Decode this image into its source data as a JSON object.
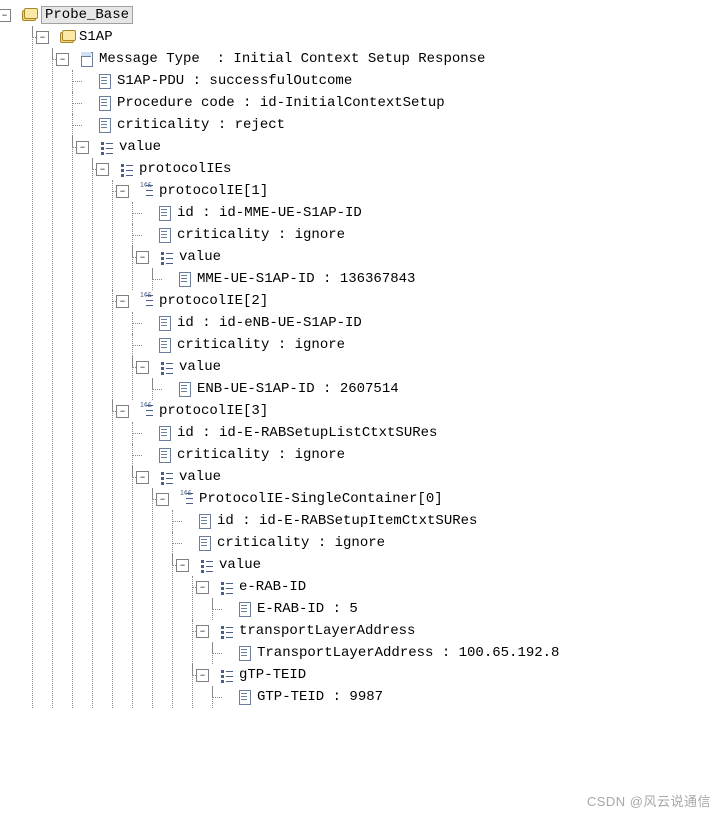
{
  "watermark": "CSDN @风云说通信",
  "tree": [
    {
      "name": "root-probe-base",
      "icon": "ic-folder",
      "exp": "minus",
      "label": "Probe_Base",
      "highlight": true,
      "interact": true,
      "children": [
        {
          "name": "node-s1ap",
          "icon": "ic-folder",
          "exp": "minus",
          "label": "S1AP",
          "interact": true,
          "children": [
            {
              "name": "node-message-type",
              "icon": "ic-page-head",
              "exp": "minus",
              "label": "Message Type  : Initial Context Setup Response",
              "interact": true,
              "children": [
                {
                  "name": "leaf-s1ap-pdu",
                  "icon": "ic-page",
                  "exp": "none",
                  "label": "S1AP-PDU : successfulOutcome",
                  "interact": false
                },
                {
                  "name": "leaf-procedure-code",
                  "icon": "ic-page",
                  "exp": "none",
                  "label": "Procedure code : id-InitialContextSetup",
                  "interact": false
                },
                {
                  "name": "leaf-criticality-top",
                  "icon": "ic-page",
                  "exp": "none",
                  "label": "criticality : reject",
                  "interact": false
                },
                {
                  "name": "node-value-top",
                  "icon": "ic-list",
                  "exp": "minus",
                  "label": "value",
                  "interact": true,
                  "children": [
                    {
                      "name": "node-protocolies",
                      "icon": "ic-list",
                      "exp": "minus",
                      "label": "protocolIEs",
                      "interact": true,
                      "children": [
                        {
                          "name": "node-protocolie-1",
                          "icon": "ic-nlist",
                          "exp": "minus",
                          "label": "protocolIE[1]",
                          "interact": true,
                          "children": [
                            {
                              "name": "leaf-ie1-id",
                              "icon": "ic-page",
                              "exp": "none",
                              "label": "id : id-MME-UE-S1AP-ID",
                              "interact": false
                            },
                            {
                              "name": "leaf-ie1-crit",
                              "icon": "ic-page",
                              "exp": "none",
                              "label": "criticality : ignore",
                              "interact": false
                            },
                            {
                              "name": "node-ie1-value",
                              "icon": "ic-list",
                              "exp": "minus",
                              "label": "value",
                              "interact": true,
                              "children": [
                                {
                                  "name": "leaf-mme-ue-s1ap-id",
                                  "icon": "ic-page",
                                  "exp": "none",
                                  "label": "MME-UE-S1AP-ID : 136367843",
                                  "interact": false
                                }
                              ]
                            }
                          ]
                        },
                        {
                          "name": "node-protocolie-2",
                          "icon": "ic-nlist",
                          "exp": "minus",
                          "label": "protocolIE[2]",
                          "interact": true,
                          "children": [
                            {
                              "name": "leaf-ie2-id",
                              "icon": "ic-page",
                              "exp": "none",
                              "label": "id : id-eNB-UE-S1AP-ID",
                              "interact": false
                            },
                            {
                              "name": "leaf-ie2-crit",
                              "icon": "ic-page",
                              "exp": "none",
                              "label": "criticality : ignore",
                              "interact": false
                            },
                            {
                              "name": "node-ie2-value",
                              "icon": "ic-list",
                              "exp": "minus",
                              "label": "value",
                              "interact": true,
                              "children": [
                                {
                                  "name": "leaf-enb-ue-s1ap-id",
                                  "icon": "ic-page",
                                  "exp": "none",
                                  "label": "ENB-UE-S1AP-ID : 2607514",
                                  "interact": false
                                }
                              ]
                            }
                          ]
                        },
                        {
                          "name": "node-protocolie-3",
                          "icon": "ic-nlist",
                          "exp": "minus",
                          "label": "protocolIE[3]",
                          "interact": true,
                          "children": [
                            {
                              "name": "leaf-ie3-id",
                              "icon": "ic-page",
                              "exp": "none",
                              "label": "id : id-E-RABSetupListCtxtSURes",
                              "interact": false
                            },
                            {
                              "name": "leaf-ie3-crit",
                              "icon": "ic-page",
                              "exp": "none",
                              "label": "criticality : ignore",
                              "interact": false
                            },
                            {
                              "name": "node-ie3-value",
                              "icon": "ic-list",
                              "exp": "minus",
                              "label": "value",
                              "interact": true,
                              "children": [
                                {
                                  "name": "node-single-container",
                                  "icon": "ic-nlist",
                                  "exp": "minus",
                                  "label": "ProtocolIE-SingleContainer[0]",
                                  "interact": true,
                                  "children": [
                                    {
                                      "name": "leaf-sc-id",
                                      "icon": "ic-page",
                                      "exp": "none",
                                      "label": "id : id-E-RABSetupItemCtxtSURes",
                                      "interact": false
                                    },
                                    {
                                      "name": "leaf-sc-crit",
                                      "icon": "ic-page",
                                      "exp": "none",
                                      "label": "criticality : ignore",
                                      "interact": false
                                    },
                                    {
                                      "name": "node-sc-value",
                                      "icon": "ic-list",
                                      "exp": "minus",
                                      "label": "value",
                                      "interact": true,
                                      "children": [
                                        {
                                          "name": "node-erab-id",
                                          "icon": "ic-list",
                                          "exp": "minus",
                                          "label": "e-RAB-ID",
                                          "interact": true,
                                          "children": [
                                            {
                                              "name": "leaf-erab-id",
                                              "icon": "ic-page",
                                              "exp": "none",
                                              "label": "E-RAB-ID : 5",
                                              "interact": false
                                            }
                                          ]
                                        },
                                        {
                                          "name": "node-transport",
                                          "icon": "ic-list",
                                          "exp": "minus",
                                          "label": "transportLayerAddress",
                                          "interact": true,
                                          "children": [
                                            {
                                              "name": "leaf-transport",
                                              "icon": "ic-page",
                                              "exp": "none",
                                              "label": "TransportLayerAddress : 100.65.192.8",
                                              "interact": false
                                            }
                                          ]
                                        },
                                        {
                                          "name": "node-gtp-teid",
                                          "icon": "ic-list",
                                          "exp": "minus",
                                          "label": "gTP-TEID",
                                          "interact": true,
                                          "children": [
                                            {
                                              "name": "leaf-gtp-teid",
                                              "icon": "ic-page",
                                              "exp": "none",
                                              "label": "GTP-TEID : 9987",
                                              "interact": false
                                            }
                                          ]
                                        }
                                      ]
                                    }
                                  ]
                                }
                              ]
                            }
                          ]
                        }
                      ]
                    }
                  ]
                }
              ]
            }
          ]
        }
      ]
    }
  ]
}
